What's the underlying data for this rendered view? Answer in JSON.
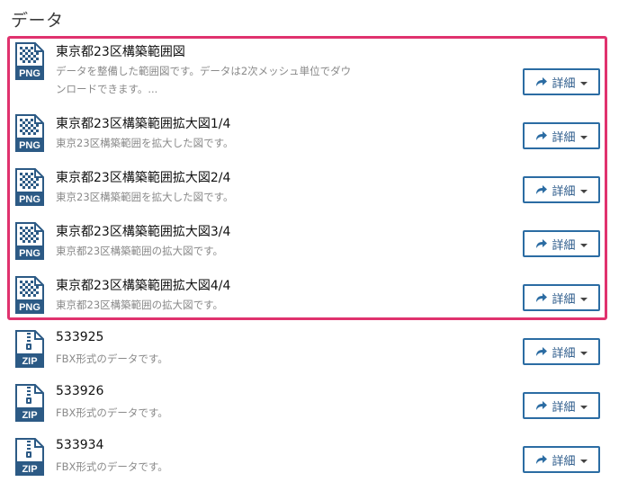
{
  "section": {
    "title": "データ"
  },
  "resources": [
    {
      "format": "PNG",
      "title": "東京都23区構築範囲図",
      "desc": "データを整備した範囲図です。データは2次メッシュ単位でダウンロードできます。...",
      "button": "詳細"
    },
    {
      "format": "PNG",
      "title": "東京都23区構築範囲拡大図1/4",
      "desc": "東京23区構築範囲を拡大した図です。",
      "button": "詳細"
    },
    {
      "format": "PNG",
      "title": "東京都23区構築範囲拡大図2/4",
      "desc": "東京23区構築範囲を拡大した図です。",
      "button": "詳細"
    },
    {
      "format": "PNG",
      "title": "東京都23区構築範囲拡大図3/4",
      "desc": "東京都23区構築範囲の拡大図です。",
      "button": "詳細"
    },
    {
      "format": "PNG",
      "title": "東京都23区構築範囲拡大図4/4",
      "desc": "東京都23区構築範囲の拡大図です。",
      "button": "詳細"
    },
    {
      "format": "ZIP",
      "title": "533925",
      "desc": "FBX形式のデータです。",
      "button": "詳細"
    },
    {
      "format": "ZIP",
      "title": "533926",
      "desc": "FBX形式のデータです。",
      "button": "詳細"
    },
    {
      "format": "ZIP",
      "title": "533934",
      "desc": "FBX形式のデータです。",
      "button": "詳細"
    }
  ],
  "colors": {
    "accent": "#2b6ca3",
    "highlight": "#e0326e",
    "icon": "#2c5a85"
  },
  "icons": {
    "png": "png-file-icon",
    "zip": "zip-file-icon",
    "share": "share-arrow-icon",
    "caret": "caret-down-icon"
  }
}
